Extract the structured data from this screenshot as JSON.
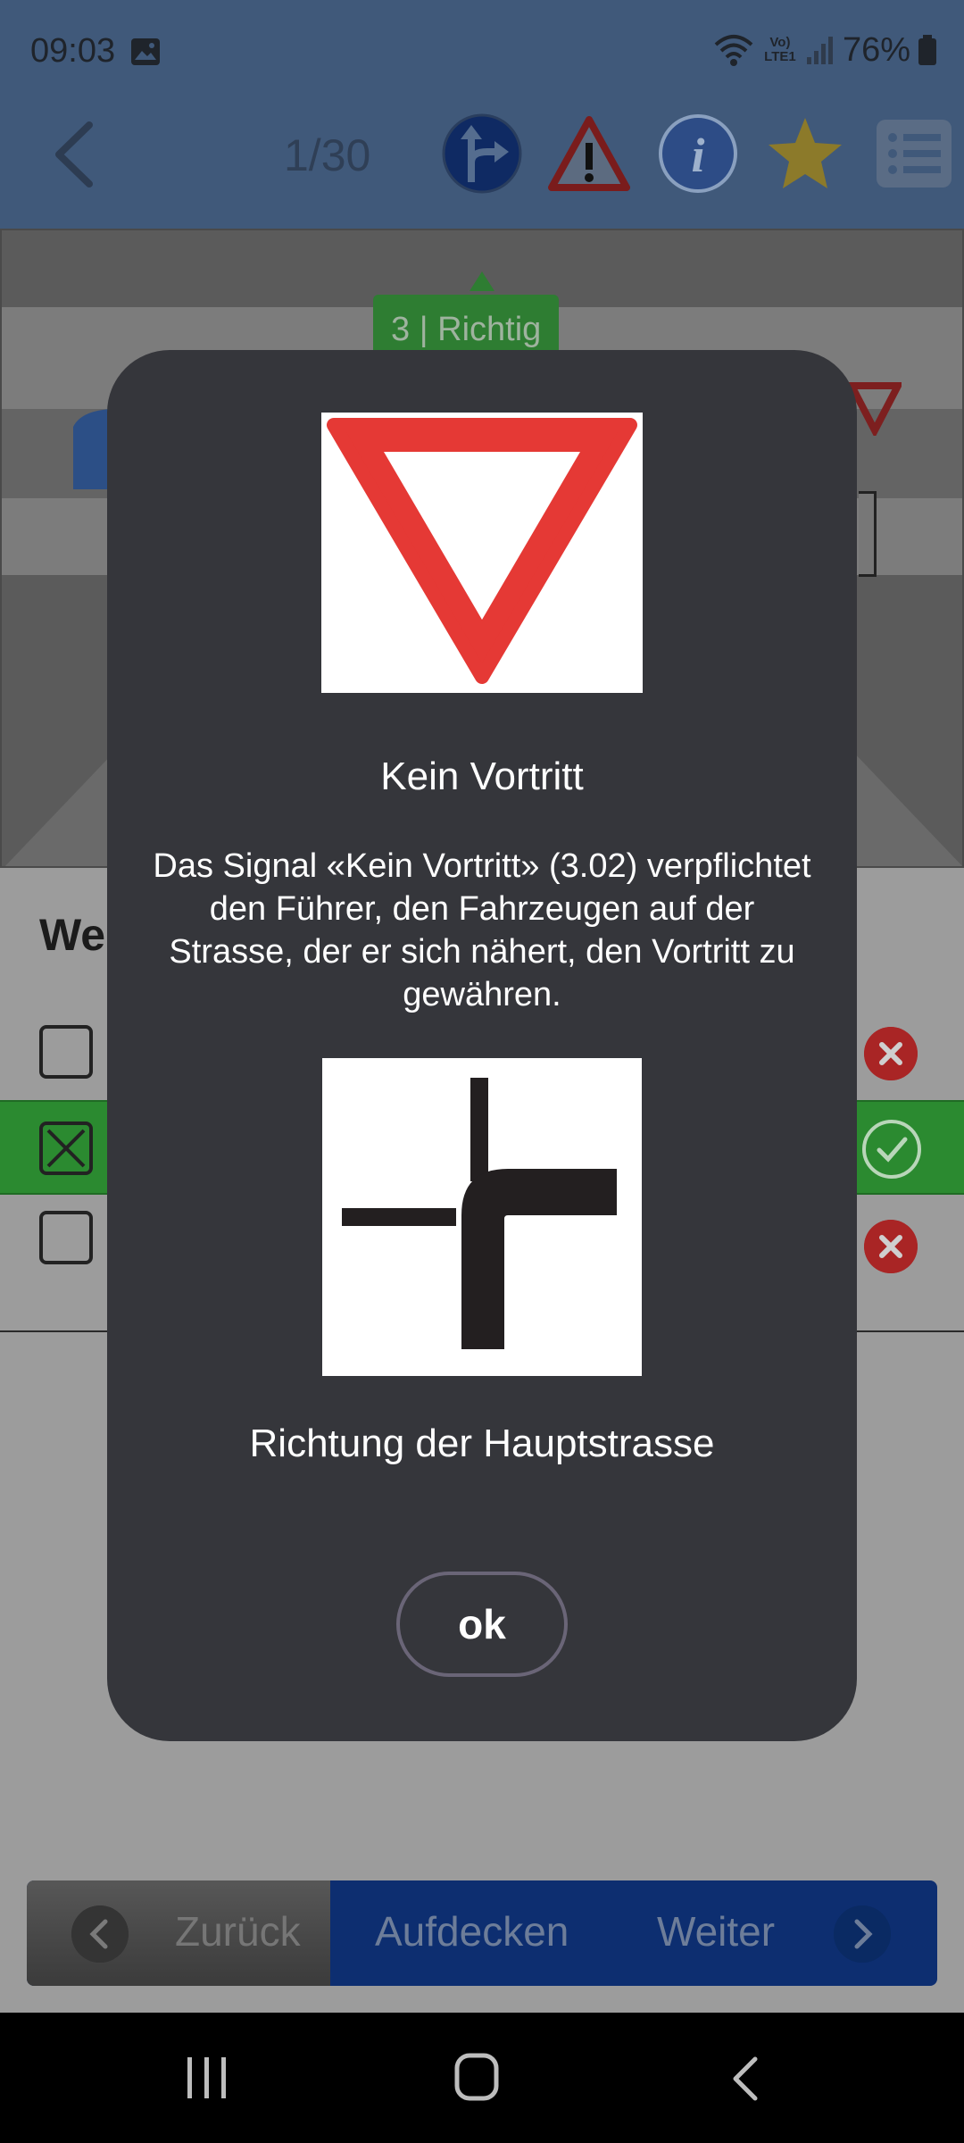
{
  "status_bar": {
    "time": "09:03",
    "network_label": "Vo) LTE1",
    "battery": "76%",
    "icons": [
      "gallery-icon",
      "wifi-icon",
      "signal-icon",
      "battery-icon"
    ]
  },
  "toolbar": {
    "counter": "1/30",
    "icons": [
      "back-icon",
      "road-direction-icon",
      "warning-icon",
      "info-icon",
      "star-icon",
      "list-icon"
    ]
  },
  "background": {
    "result_badge": "3 | Richtig",
    "question_fragment": "We",
    "answers": [
      {
        "checked": false,
        "correct": false
      },
      {
        "checked": true,
        "correct": true
      },
      {
        "checked": false,
        "correct": false
      }
    ]
  },
  "dialog": {
    "sign1_title": "Kein Vortritt",
    "sign1_description": "Das Signal «Kein Vortritt» (3.02) verpflichtet den Führer, den Fahrzeugen auf der Strasse, der er sich nähert, den Vortritt zu gewähren.",
    "sign2_title": "Richtung der Hauptstrasse",
    "ok_label": "ok"
  },
  "bottom_nav": {
    "prev_label": "Zurück",
    "reveal_label": "Aufdecken",
    "next_label": "Weiter"
  },
  "system_nav": [
    "recent-apps-icon",
    "home-icon",
    "back-icon"
  ],
  "colors": {
    "header": "#40597a",
    "dialog": "#35363b",
    "correct_green": "#2b8a30",
    "wrong_red": "#a92525",
    "nav_blue": "#0d2e70",
    "sign_red": "#e53935"
  }
}
